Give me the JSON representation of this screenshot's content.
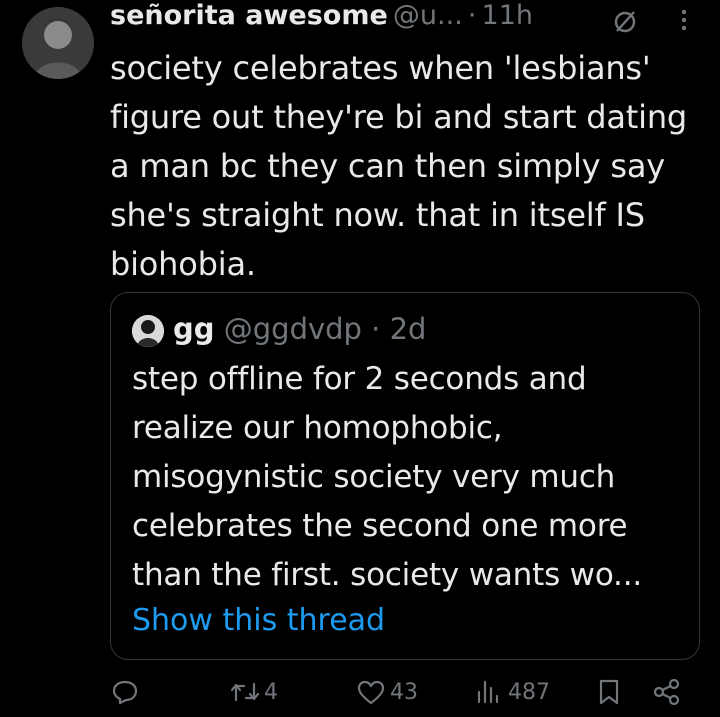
{
  "tweet": {
    "display_name": "señorita awesome",
    "handle": "@u...",
    "separator": "·",
    "time": "11h",
    "lines": [
      "society celebrates when 'lesbians'",
      "figure out they're bi and start dating",
      "a man bc they can then simply say",
      "she's straight now. that in itself IS",
      "biohobia."
    ],
    "icons": {
      "muted": "muted-circle-slash-icon",
      "more": "more-vertical-icon"
    }
  },
  "quote": {
    "display_name": "gg",
    "handle": "@ggdvdp",
    "separator": "·",
    "time": "2d",
    "lines": [
      "step offline for 2 seconds and",
      "realize our homophobic,",
      "misogynistic society very much",
      "celebrates the second one more",
      "than the first. society wants wo..."
    ],
    "show_thread": "Show this thread"
  },
  "actions": {
    "reply_count": "",
    "retweet_count": "4",
    "like_count": "43",
    "view_count": "487",
    "icons": [
      "reply-icon",
      "retweet-icon",
      "like-icon",
      "views-icon",
      "bookmark-icon",
      "share-icon"
    ]
  },
  "colors": {
    "background": "#000000",
    "text": "#e7e9ea",
    "muted": "#71767b",
    "link": "#1d9bf0",
    "border": "#333639"
  }
}
